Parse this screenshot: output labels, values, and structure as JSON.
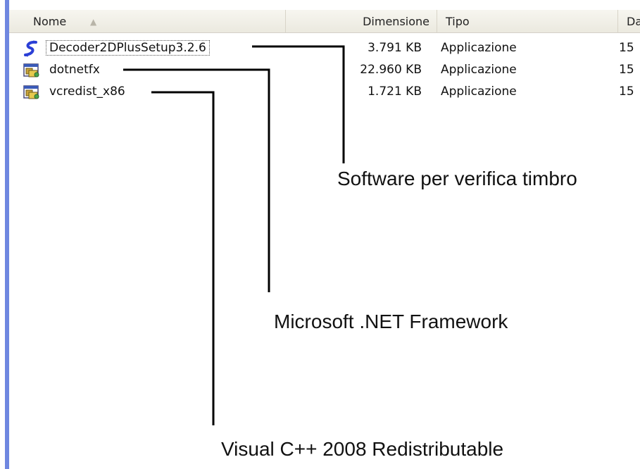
{
  "columns": {
    "name": "Nome",
    "size": "Dimensione",
    "type": "Tipo",
    "date": "Da"
  },
  "files": [
    {
      "name": "Decoder2DPlusSetup3.2.6",
      "size": "3.791 KB",
      "type": "Applicazione",
      "date": "15",
      "icon": "setup-s-icon"
    },
    {
      "name": "dotnetfx",
      "size": "22.960 KB",
      "type": "Applicazione",
      "date": "15",
      "icon": "installer-icon"
    },
    {
      "name": "vcredist_x86",
      "size": "1.721 KB",
      "type": "Applicazione",
      "date": "15",
      "icon": "installer-icon"
    }
  ],
  "annotations": {
    "decoder": "Software per verifica timbro",
    "dotnet": "Microsoft .NET Framework",
    "vcredist": "Visual C++ 2008 Redistributable"
  },
  "colors": {
    "left_strip": "#6f87e0",
    "header_bg": "#ebe9df",
    "callout_line": "#000000"
  }
}
